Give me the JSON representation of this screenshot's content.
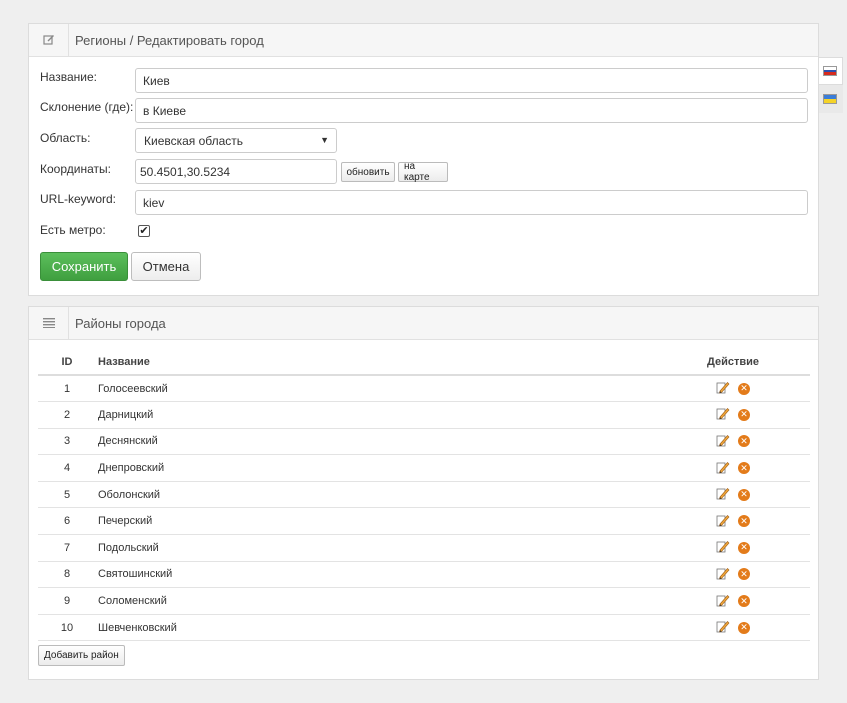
{
  "edit_panel": {
    "title": "Регионы / Редактировать город",
    "fields": {
      "name_label": "Название:",
      "name_value": "Киев",
      "declension_label": "Склонение (где):",
      "declension_value": "в Киеве",
      "region_label": "Область:",
      "region_value": "Киевская область",
      "coords_label": "Координаты:",
      "coords_value": "50.4501,30.5234",
      "update_button": "обновить",
      "map_button": "на карте",
      "url_label": "URL-keyword:",
      "url_value": "kiev",
      "metro_label": "Есть метро:",
      "metro_checked": true
    },
    "save_button": "Сохранить",
    "cancel_button": "Отмена"
  },
  "languages": [
    {
      "icon": "russia-flag-icon"
    },
    {
      "icon": "ukraine-flag-icon"
    }
  ],
  "districts_panel": {
    "title": "Районы города",
    "columns": {
      "id": "ID",
      "name": "Название",
      "action": "Действие"
    },
    "rows": [
      {
        "id": "1",
        "name": "Голосеевский"
      },
      {
        "id": "2",
        "name": "Дарницкий"
      },
      {
        "id": "3",
        "name": "Деснянский"
      },
      {
        "id": "4",
        "name": "Днепровский"
      },
      {
        "id": "5",
        "name": "Оболонский"
      },
      {
        "id": "6",
        "name": "Печерский"
      },
      {
        "id": "7",
        "name": "Подольский"
      },
      {
        "id": "8",
        "name": "Святошинский"
      },
      {
        "id": "9",
        "name": "Соломенский"
      },
      {
        "id": "10",
        "name": "Шевченковский"
      }
    ],
    "add_button": "Добавить район"
  },
  "colors": {
    "save_green": "#4cae4c",
    "delete_orange": "#e37b1a",
    "background": "#efefef"
  }
}
